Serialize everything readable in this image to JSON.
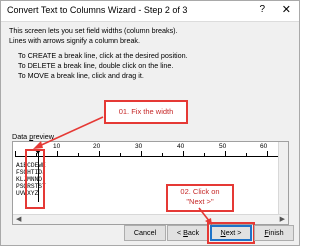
{
  "window": {
    "title": "Convert Text to Columns Wizard - Step 2 of 3",
    "help_glyph": "?",
    "close_glyph": "✕"
  },
  "instructions": {
    "line1": "This screen lets you set field widths (column breaks).",
    "line2": "Lines with arrows signify a column break.",
    "create": "To CREATE a break line, click at the desired position.",
    "delete": "To DELETE a break line, double click on the line.",
    "move": "To MOVE a break line, click and drag it."
  },
  "preview": {
    "label_prefix": "Data ",
    "label_accel": "p",
    "label_suffix": "review",
    "ruler_numbers": [
      "10",
      "20",
      "30",
      "40",
      "50",
      "60"
    ],
    "rows": [
      "A1BCDEWE",
      "FSGHTIDJ",
      "KLJMNNO",
      "PSQRSTST",
      "UVWXYZ"
    ]
  },
  "annotations": {
    "fix_width": "01. Fix the width",
    "click_next": "02. Click on\n\"Next >\""
  },
  "buttons": {
    "cancel": "Cancel",
    "back_accel": "B",
    "back_prefix": "< ",
    "back_suffix": "ack",
    "next_accel": "N",
    "next_suffix": "ext >",
    "finish_accel": "F",
    "finish_suffix": "inish"
  }
}
